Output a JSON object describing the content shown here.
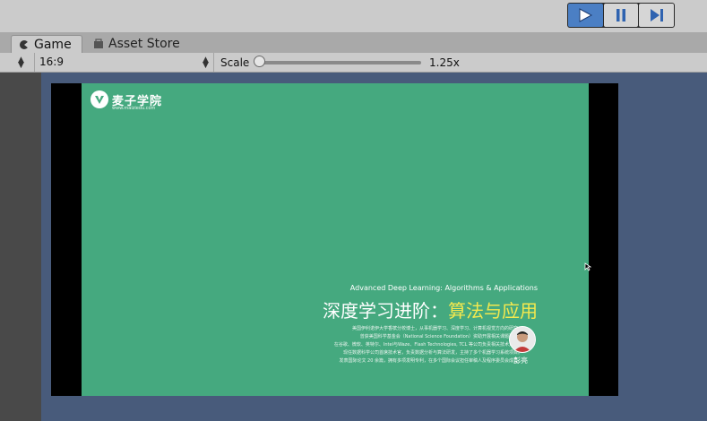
{
  "toolbar": {
    "play_icon": "play-icon",
    "pause_icon": "pause-icon",
    "step_icon": "step-icon",
    "accent": "#4b7fc4"
  },
  "tabs": [
    {
      "label": "Game",
      "icon": "game-icon"
    },
    {
      "label": "Asset Store",
      "icon": "asset-store-icon"
    }
  ],
  "gamebar": {
    "aspect_value": "16:9",
    "scale_label": "Scale",
    "scale_value": "1.25x"
  },
  "slide": {
    "bg_color": "#45a97f",
    "logo_name": "麦子学院",
    "logo_url": "www.maiziedu.com",
    "en_title": "Advanced Deep Learning: Algorithms & Applications",
    "zh_title_a": "深度学习进阶：",
    "zh_title_b": "算法与应用",
    "highlight_color": "#f4e94e",
    "description": [
      "美国伊利诺伊大学香槟分校博士，从事机器学习、深度学习、计算机视觉方向的研究。",
      "曾获美国科学基金会（National Science Foundation）资助开展相关课题研究。",
      "在谷歌、微软、英特尔、Intel与Waze、Flash Technologies, TCL 等公司负责相关技术方案。",
      "现任数据科学公司首席技术官，负责数据分析与算法研发，主持了多个机器学习系统项目。",
      "发表国际论文 20 余篇，拥有多项发明专利，在多个国际会议担任审稿人及程序委员会成员。"
    ],
    "speaker": "彭亮"
  }
}
